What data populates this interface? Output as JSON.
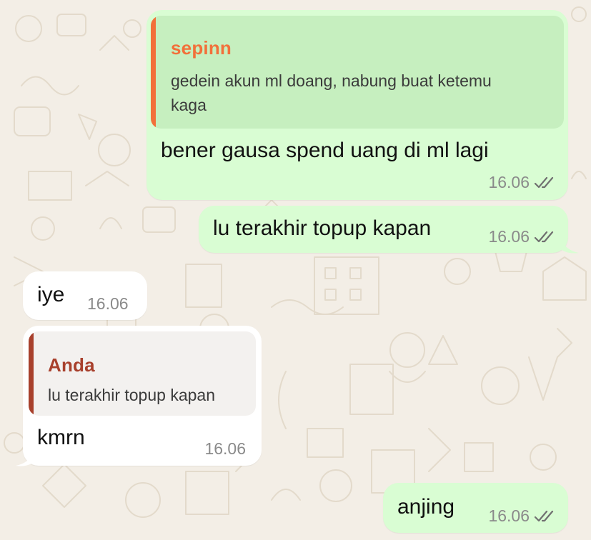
{
  "messages": [
    {
      "id": "m1",
      "direction": "outgoing",
      "reply": {
        "author": "sepinn",
        "text_line1": "gedein akun ml doang, nabung buat ketemu",
        "text_line2": "kaga"
      },
      "text": "bener gausa spend uang di ml lagi",
      "time": "16.06",
      "status": "double-check-icon"
    },
    {
      "id": "m2",
      "direction": "outgoing",
      "text": "lu terakhir topup kapan",
      "time": "16.06",
      "status": "double-check-icon"
    },
    {
      "id": "m3",
      "direction": "incoming",
      "text": "iye",
      "time": "16.06"
    },
    {
      "id": "m4",
      "direction": "incoming",
      "reply": {
        "author": "Anda",
        "text": "lu terakhir topup kapan"
      },
      "text": "kmrn",
      "time": "16.06"
    },
    {
      "id": "m5",
      "direction": "outgoing",
      "text": "anjing",
      "time": "16.06",
      "status": "double-check-icon"
    }
  ],
  "colors": {
    "outgoing_bubble": "#d9fdd3",
    "incoming_bubble": "#ffffff",
    "reply_author_sepinn": "#f2703a",
    "reply_author_anda": "#a8402c",
    "wallpaper": "#f3eee6"
  }
}
